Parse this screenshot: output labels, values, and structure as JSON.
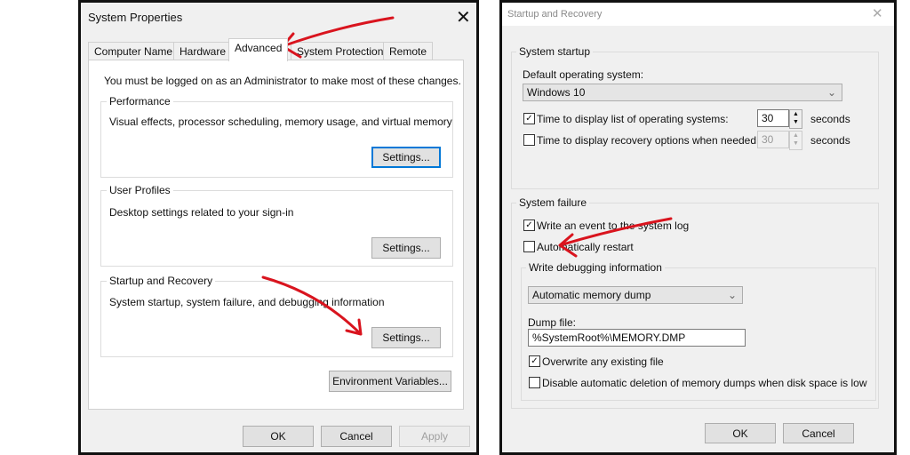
{
  "left": {
    "title": "System Properties",
    "tabs": [
      "Computer Name",
      "Hardware",
      "Advanced",
      "System Protection",
      "Remote"
    ],
    "admin_note": "You must be logged on as an Administrator to make most of these changes.",
    "performance": {
      "label": "Performance",
      "desc": "Visual effects, processor scheduling, memory usage, and virtual memory",
      "button": "Settings..."
    },
    "profiles": {
      "label": "User Profiles",
      "desc": "Desktop settings related to your sign-in",
      "button": "Settings..."
    },
    "startup": {
      "label": "Startup and Recovery",
      "desc": "System startup, system failure, and debugging information",
      "button": "Settings..."
    },
    "env_button": "Environment Variables...",
    "ok": "OK",
    "cancel": "Cancel",
    "apply": "Apply"
  },
  "right": {
    "title": "Startup and Recovery",
    "system_startup": {
      "label": "System startup",
      "default_os_label": "Default operating system:",
      "default_os": "Windows 10",
      "time_list": {
        "label": "Time to display list of operating systems:",
        "checked": true,
        "value": "30",
        "unit": "seconds"
      },
      "time_recovery": {
        "label": "Time to display recovery options when needed:",
        "checked": false,
        "value": "30",
        "unit": "seconds"
      }
    },
    "system_failure": {
      "label": "System failure",
      "write_event": {
        "label": "Write an event to the system log",
        "checked": true
      },
      "auto_restart": {
        "label": "Automatically restart",
        "checked": false
      },
      "debug": {
        "label": "Write debugging information",
        "type": "Automatic memory dump",
        "dump_label": "Dump file:",
        "dump_file": "%SystemRoot%\\MEMORY.DMP",
        "overwrite": {
          "label": "Overwrite any existing file",
          "checked": true
        },
        "disable_delete": {
          "label": "Disable automatic deletion of memory dumps when disk space is low",
          "checked": false
        }
      }
    },
    "ok": "OK",
    "cancel": "Cancel"
  },
  "colors": {
    "annotation_arrow": "#d9141e",
    "focus": "#0078d7"
  }
}
